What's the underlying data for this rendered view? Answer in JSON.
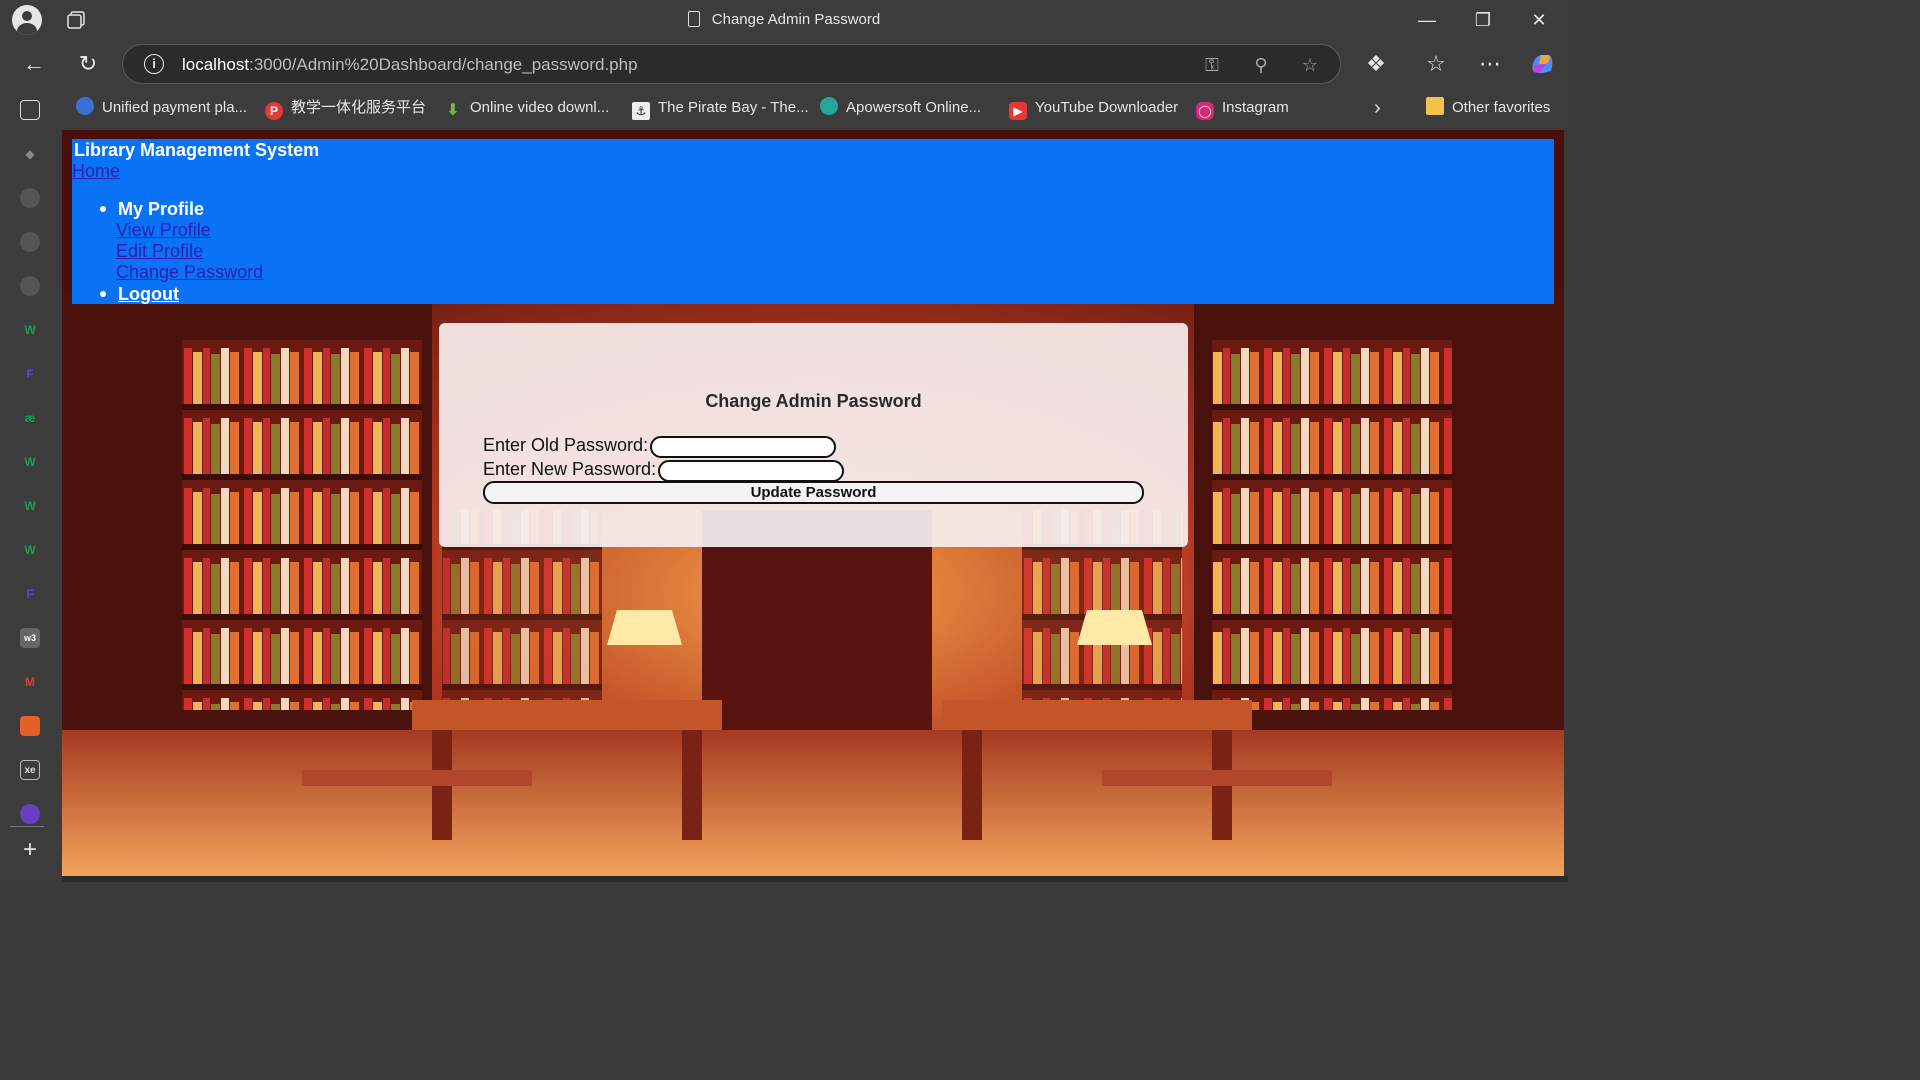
{
  "browser": {
    "window_title": "Change Admin Password",
    "url_host": "localhost",
    "url_path": ":3000/Admin%20Dashboard/change_password.php",
    "bookmarks": [
      {
        "label": "Unified payment pla...",
        "icon": "upi-icon",
        "color": "#3b6fd8"
      },
      {
        "label": "教学一体化服务平台",
        "icon": "p-logo-icon",
        "color": "#e53935"
      },
      {
        "label": "Online video downl...",
        "icon": "download-arrow-icon",
        "color": "#7cb342"
      },
      {
        "label": "The Pirate Bay - The...",
        "icon": "pirate-ship-icon",
        "color": "#e0e0e0"
      },
      {
        "label": "Apowersoft Online...",
        "icon": "apowersoft-icon",
        "color": "#26a69a"
      },
      {
        "label": "YouTube Downloader",
        "icon": "youtube-icon",
        "color": "#e53935"
      },
      {
        "label": "Instagram",
        "icon": "instagram-icon",
        "color": "#d62976"
      }
    ],
    "other_favorites": "Other favorites"
  },
  "page": {
    "site_title": "Library Management System",
    "home_link": "Home",
    "nav": {
      "profile_heading": "My Profile",
      "sub_links": [
        "View Profile",
        "Edit Profile",
        "Change Password"
      ],
      "logout": "Logout"
    },
    "form": {
      "title": "Change Admin Password",
      "old_password_label": "Enter Old Password:",
      "old_password_value": "",
      "new_password_label": "Enter New Password:",
      "new_password_value": "",
      "submit_label": "Update Password"
    },
    "colors": {
      "navbar": "#0a72f5",
      "link": "#2b1fb8"
    }
  }
}
